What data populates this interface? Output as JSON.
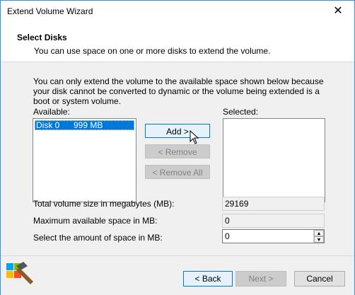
{
  "window": {
    "title": "Extend Volume Wizard",
    "close_glyph": "✕"
  },
  "header": {
    "title": "Select Disks",
    "subtitle": "You can use space on one or more disks to extend the volume."
  },
  "description": "You can only extend the volume to the available space shown below because your disk cannot be converted to dynamic or the volume being extended is a boot or system volume.",
  "available": {
    "label": "Available:",
    "items": [
      {
        "disk": "Disk 0",
        "size": "999 MB",
        "selected": true
      }
    ]
  },
  "selected": {
    "label": "Selected:",
    "items": []
  },
  "buttons": {
    "add": "Add >",
    "remove": "< Remove",
    "remove_all": "< Remove All"
  },
  "fields": {
    "total": {
      "label": "Total volume size in megabytes (MB):",
      "value": "29169"
    },
    "max": {
      "label": "Maximum available space in MB:",
      "value": "0"
    },
    "amount": {
      "label": "Select the amount of space in MB:",
      "value": "0"
    }
  },
  "footer": {
    "back": "< Back",
    "next": "Next >",
    "cancel": "Cancel"
  },
  "colors": {
    "accent": "#0078d7",
    "window_border": "#3c8fd6",
    "desktop": "#2b7fd8"
  }
}
